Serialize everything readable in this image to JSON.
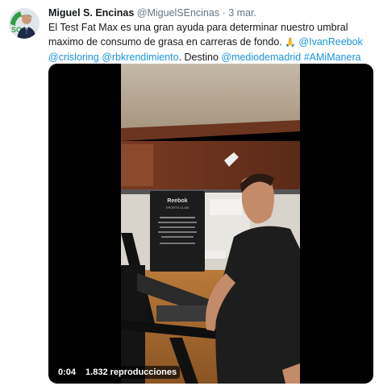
{
  "tweet": {
    "author_name": "Miguel S. Encinas",
    "author_handle": "@MiguelSEncinas",
    "separator": "·",
    "date": "3 mar.",
    "text_part1": "El Test Fat Max es una gran ayuda para determinar nuestro umbral maximo de consumo de grasa en carreras de fondo. ",
    "emoji": "🙏",
    "mention1": "@IvanReebok",
    "mention2": "@crisloring",
    "mention3": "@rbkrendimiento",
    "text_part2": ". Destino ",
    "mention4": "@mediodemadrid",
    "hashtag": "#AMiManera",
    "avatar_icon": "profile-photo-icon"
  },
  "video": {
    "elapsed": "0:04",
    "views": "1.832 reproducciones",
    "sign_brand": "Reebok",
    "sign_subtitle": "SPORTS CLUB"
  },
  "colors": {
    "link": "#1b95e0",
    "secondary_text": "#657786",
    "video_bg": "#000000"
  }
}
